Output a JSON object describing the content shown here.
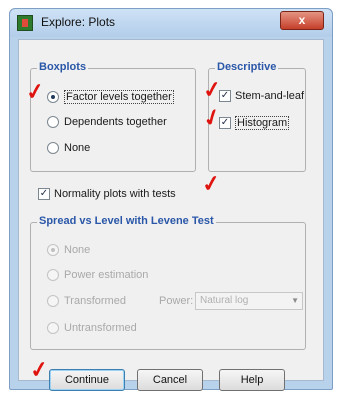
{
  "window": {
    "title": "Explore: Plots",
    "close_glyph": "x"
  },
  "boxplots": {
    "legend": "Boxplots",
    "options": [
      {
        "label": "Factor levels together",
        "selected": true
      },
      {
        "label": "Dependents together",
        "selected": false
      },
      {
        "label": "None",
        "selected": false
      }
    ]
  },
  "descriptive": {
    "legend": "Descriptive",
    "options": [
      {
        "label": "Stem-and-leaf",
        "checked": true
      },
      {
        "label": "Histogram",
        "checked": true
      }
    ]
  },
  "normality": {
    "label": "Normality plots with tests",
    "checked": true
  },
  "spread": {
    "legend": "Spread vs Level with Levene Test",
    "options": [
      {
        "label": "None",
        "selected": true
      },
      {
        "label": "Power estimation",
        "selected": false
      },
      {
        "label": "Transformed",
        "selected": false
      },
      {
        "label": "Untransformed",
        "selected": false
      }
    ],
    "power_label": "Power:",
    "power_value": "Natural log"
  },
  "buttons": {
    "continue": "Continue",
    "cancel": "Cancel",
    "help": "Help"
  },
  "annotations": {
    "check_mark": "✓",
    "mark_color": "#e0140f"
  },
  "icons": {
    "dropdown_arrow": "▼",
    "checkbox_glyph": "✓"
  }
}
